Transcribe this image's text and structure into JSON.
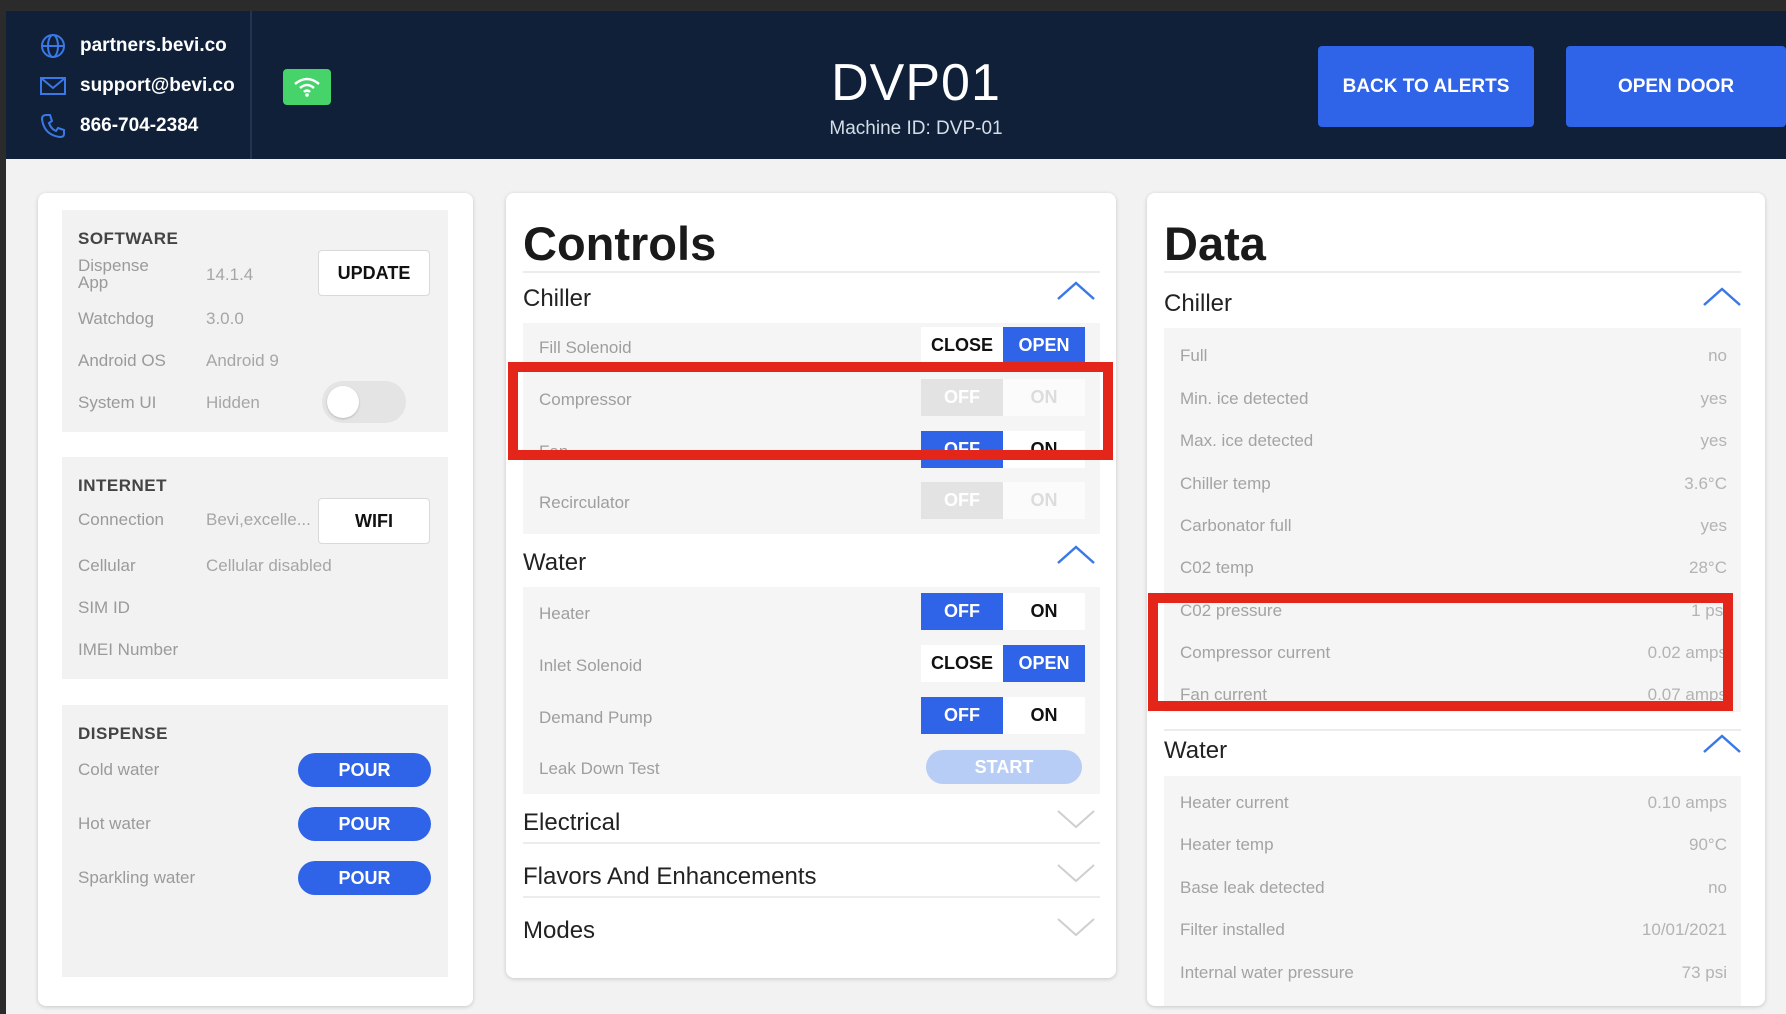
{
  "header": {
    "website": "partners.bevi.co",
    "email": "support@bevi.co",
    "phone": "866-704-2384",
    "title": "DVP01",
    "machine_id": "Machine ID: DVP-01",
    "back_to_alerts": "BACK TO ALERTS",
    "open_door": "OPEN DOOR",
    "wifi_status_color": "#45d36a"
  },
  "software": {
    "title": "SOFTWARE",
    "dispense_app_label": "Dispense App",
    "dispense_app_value": "14.1.4",
    "update_button": "UPDATE",
    "watchdog_label": "Watchdog",
    "watchdog_value": "3.0.0",
    "android_label": "Android OS",
    "android_value": "Android 9",
    "system_ui_label": "System UI",
    "system_ui_value": "Hidden"
  },
  "internet": {
    "title": "INTERNET",
    "connection_label": "Connection",
    "connection_value": "Bevi,excelle...",
    "wifi_button": "WIFI",
    "cellular_label": "Cellular",
    "cellular_value": "Cellular disabled",
    "sim_label": "SIM ID",
    "imei_label": "IMEI Number"
  },
  "dispense": {
    "title": "DISPENSE",
    "items": [
      {
        "label": "Cold water",
        "button": "POUR"
      },
      {
        "label": "Hot water",
        "button": "POUR"
      },
      {
        "label": "Sparkling water",
        "button": "POUR"
      }
    ]
  },
  "controls": {
    "title": "Controls",
    "chiller": {
      "heading": "Chiller",
      "fill_solenoid": {
        "label": "Fill Solenoid",
        "off": "CLOSE",
        "on": "OPEN"
      },
      "compressor": {
        "label": "Compressor",
        "off": "OFF",
        "on": "ON"
      },
      "fan": {
        "label": "Fan",
        "off": "OFF",
        "on": "ON"
      },
      "recirculator": {
        "label": "Recirculator",
        "off": "OFF",
        "on": "ON"
      }
    },
    "water": {
      "heading": "Water",
      "heater": {
        "label": "Heater",
        "off": "OFF",
        "on": "ON"
      },
      "inlet_solenoid": {
        "label": "Inlet Solenoid",
        "off": "CLOSE",
        "on": "OPEN"
      },
      "demand_pump": {
        "label": "Demand Pump",
        "off": "OFF",
        "on": "ON"
      },
      "leak_down": {
        "label": "Leak Down Test",
        "button": "START"
      }
    },
    "electrical": "Electrical",
    "flavors": "Flavors And Enhancements",
    "modes": "Modes"
  },
  "data": {
    "title": "Data",
    "chiller_heading": "Chiller",
    "chiller_rows": [
      {
        "label": "Full",
        "value": "no"
      },
      {
        "label": "Min. ice detected",
        "value": "yes"
      },
      {
        "label": "Max. ice detected",
        "value": "yes"
      },
      {
        "label": "Chiller temp",
        "value": "3.6°C"
      },
      {
        "label": "Carbonator full",
        "value": "yes"
      },
      {
        "label": "C02 temp",
        "value": "28°C"
      },
      {
        "label": "C02 pressure",
        "value": "1 psi"
      },
      {
        "label": "Compressor current",
        "value": "0.02 amps"
      },
      {
        "label": "Fan current",
        "value": "0.07 amps"
      }
    ],
    "water_heading": "Water",
    "water_rows": [
      {
        "label": "Heater current",
        "value": "0.10 amps"
      },
      {
        "label": "Heater temp",
        "value": "90°C"
      },
      {
        "label": "Base leak detected",
        "value": "no"
      },
      {
        "label": "Filter installed",
        "value": "10/01/2021"
      },
      {
        "label": "Internal water pressure",
        "value": "73 psi"
      }
    ]
  },
  "colors": {
    "header_bg": "#0f2038",
    "accent_blue": "#2f63e8",
    "highlight_red": "#e3251a"
  }
}
